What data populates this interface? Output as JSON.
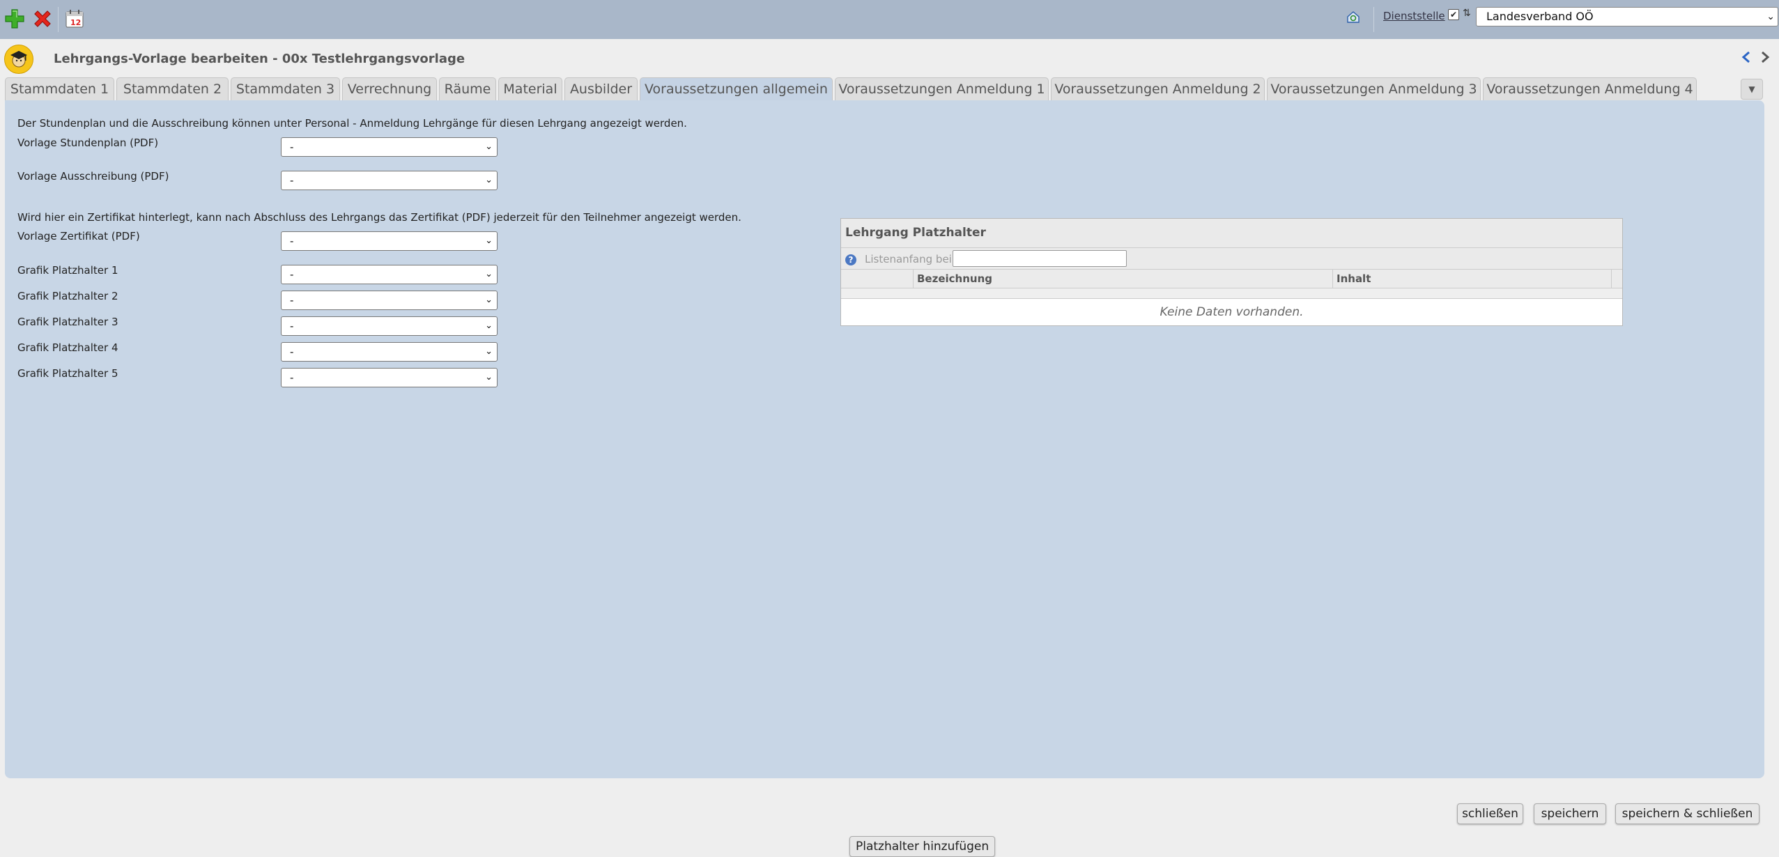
{
  "toolbar": {
    "dienststelle_label": "Dienststelle",
    "checkbox_checked": "✔",
    "sort_glyph": "⇅",
    "dienststelle_value": "Landesverband OÖ",
    "calendar_day": "12"
  },
  "header": {
    "title": "Lehrgangs-Vorlage bearbeiten - 00x Testlehrgangsvorlage"
  },
  "tabs": [
    {
      "label": "Stammdaten 1"
    },
    {
      "label": "Stammdaten 2"
    },
    {
      "label": "Stammdaten 3"
    },
    {
      "label": "Verrechnung"
    },
    {
      "label": "Räume"
    },
    {
      "label": "Material"
    },
    {
      "label": "Ausbilder"
    },
    {
      "label": "Voraussetzungen allgemein"
    },
    {
      "label": "Voraussetzungen Anmeldung 1"
    },
    {
      "label": "Voraussetzungen Anmeldung 2"
    },
    {
      "label": "Voraussetzungen Anmeldung 3"
    },
    {
      "label": "Voraussetzungen Anmeldung 4"
    }
  ],
  "form": {
    "info_top": "Der Stundenplan und die Ausschreibung können unter Personal - Anmeldung Lehrgänge für diesen Lehrgang angezeigt werden.",
    "info_mid": "Wird hier ein Zertifikat hinterlegt, kann nach Abschluss des Lehrgangs das Zertifikat (PDF) jederzeit für den Teilnehmer angezeigt werden.",
    "fields": [
      {
        "label": "Vorlage Stundenplan (PDF)",
        "value": "-"
      },
      {
        "label": "Vorlage Ausschreibung (PDF)",
        "value": "-"
      },
      {
        "label": "Vorlage Zertifikat (PDF)",
        "value": "-"
      },
      {
        "label": "Grafik Platzhalter 1",
        "value": "-"
      },
      {
        "label": "Grafik Platzhalter 2",
        "value": "-"
      },
      {
        "label": "Grafik Platzhalter 3",
        "value": "-"
      },
      {
        "label": "Grafik Platzhalter 4",
        "value": "-"
      },
      {
        "label": "Grafik Platzhalter 5",
        "value": "-"
      }
    ]
  },
  "grid": {
    "title": "Lehrgang Platzhalter",
    "filter_label": "Listenanfang bei:",
    "filter_value": "",
    "columns": [
      "Bezeichnung",
      "Inhalt"
    ],
    "empty_text": "Keine Daten vorhanden."
  },
  "buttons": {
    "add_placeholder": "Platzhalter hinzufügen",
    "close": "schließen",
    "save": "speichern",
    "save_close": "speichern & schließen"
  },
  "colors": {
    "topbar": "#a9b7c9",
    "panel": "#c8d6e6",
    "page_bg": "#eeeeee"
  }
}
